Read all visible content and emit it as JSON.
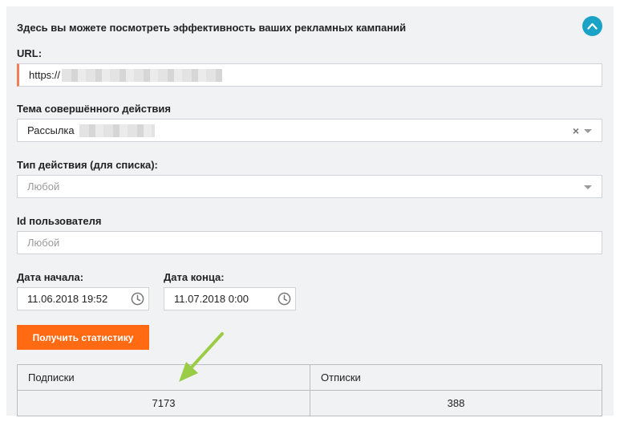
{
  "header": {
    "title": "Здесь вы можете посмотреть эффективность ваших рекламных кампаний",
    "collapse_icon": "chevron-up-icon",
    "collapse_color": "#1aa3c7"
  },
  "url_field": {
    "label": "URL:",
    "value": "https://"
  },
  "topic_field": {
    "label": "Тема совершённого действия",
    "value": "Рассылка",
    "clear_glyph": "×"
  },
  "action_type_field": {
    "label": "Тип действия (для списка):",
    "placeholder": "Любой"
  },
  "user_id_field": {
    "label": "Id пользователя",
    "placeholder": "Любой"
  },
  "start_date": {
    "label": "Дата начала:",
    "value": "11.06.2018 19:52"
  },
  "end_date": {
    "label": "Дата конца:",
    "value": "11.07.2018 0:00"
  },
  "get_stats_button": {
    "label": "Получить статистику",
    "color": "#ff6a13"
  },
  "stats_table": {
    "columns": [
      "Подписки",
      "Отписки"
    ],
    "values": [
      "7173",
      "388"
    ]
  },
  "accent_colors": {
    "url_accent": "#f07f55",
    "annotation_arrow": "#9bcc45"
  }
}
